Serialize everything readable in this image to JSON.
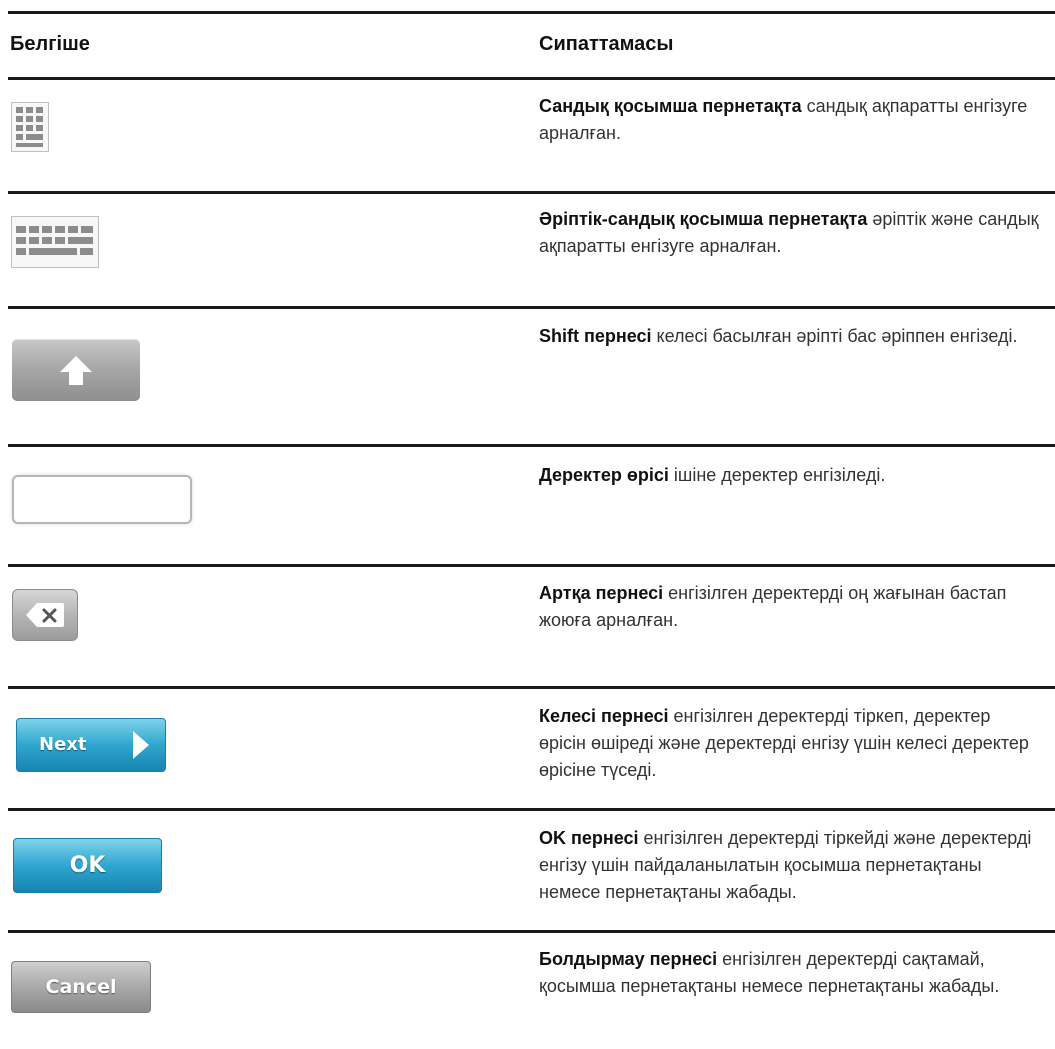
{
  "header": {
    "col_icon": "Белгіше",
    "col_desc": "Сипаттамасы"
  },
  "rows": [
    {
      "icon": "numeric-keypad-icon",
      "title": "Сандық қосымша пернетақта",
      "text": " сандық ақпаратты енгізуге арналған."
    },
    {
      "icon": "alphanumeric-keyboard-icon",
      "title": "Әріптік-сандық қосымша пернетақта",
      "text": " әріптік және сандық ақпаратты енгізуге арналған."
    },
    {
      "icon": "shift-arrow-icon",
      "title": "Shift пернесі",
      "text": " келесі басылған әріпті бас әріппен енгізеді."
    },
    {
      "icon": "data-field",
      "title": "Деректер өрісі",
      "text": " ішіне деректер енгізіледі."
    },
    {
      "icon": "backspace-icon",
      "title": "Артқа пернесі",
      "text": " енгізілген деректерді оң жағынан бастап жоюға арналған."
    },
    {
      "icon": "chevron-right-icon",
      "button_label": "Next",
      "title": "Келесі пернесі",
      "text": " енгізілген деректерді тіркеп, деректер өрісін өшіреді және деректерді енгізу үшін келесі деректер өрісіне түседі."
    },
    {
      "icon": "ok-button",
      "button_label": "OK",
      "title": "OK пернесі",
      "text": " енгізілген деректерді тіркейді және деректерді енгізу үшін пайдаланылатын қосымша пернетақтаны немесе пернетақтаны жабады."
    },
    {
      "icon": "cancel-button",
      "button_label": "Cancel",
      "title": "Болдырмау пернесі",
      "text": " енгізілген деректерді сақтамай, қосымша пернетақтаны немесе пернетақтаны жабады."
    }
  ],
  "colors": {
    "accent_blue": "#2fa6cf",
    "key_gray": "#a8a8a8",
    "rule": "#1a1a1a"
  }
}
